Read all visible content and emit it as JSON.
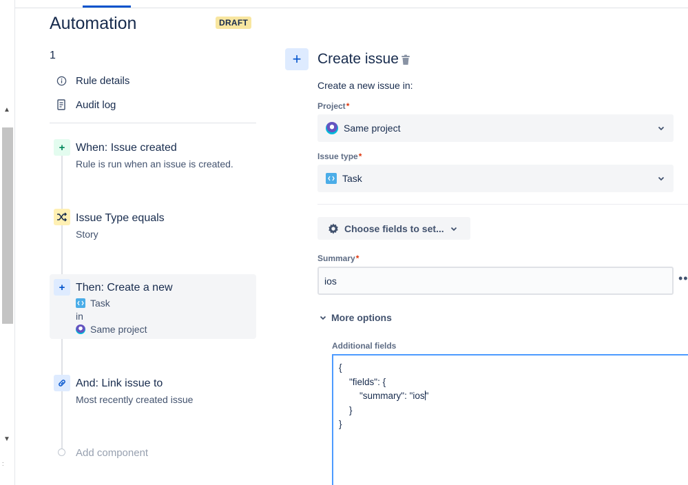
{
  "header": {
    "title": "Automation",
    "badge": "DRAFT",
    "rule_number": "1"
  },
  "menu": {
    "rule_details": "Rule details",
    "audit_log": "Audit log"
  },
  "rule_steps": [
    {
      "title": "When: Issue created",
      "subtitle": "Rule is run when an issue is created.",
      "icon": "plus-icon",
      "color": "#e3fcef"
    },
    {
      "title": "Issue Type equals",
      "subtitle": "Story",
      "icon": "shuffle-icon",
      "color": "#fff0b3"
    },
    {
      "title": "Then: Create a new",
      "line1": "Task",
      "line2": "in",
      "line3": "Same project",
      "icon": "plus-icon",
      "color": "#deebff"
    },
    {
      "title": "And: Link issue to",
      "subtitle": "Most recently created issue",
      "icon": "link-icon",
      "color": "#deebff"
    }
  ],
  "add_component": "Add component",
  "action": {
    "title": "Create issue",
    "description": "Create a new issue in:",
    "project_label": "Project",
    "project_value": "Same project",
    "issue_type_label": "Issue type",
    "issue_type_value": "Task",
    "required_mark": "*",
    "choose_fields_label": "Choose fields to set...",
    "summary_label": "Summary",
    "summary_value": "ios",
    "more_dots": "••",
    "more_options_label": "More options",
    "additional_fields_label": "Additional fields",
    "json_lines": [
      "{",
      "    \"fields\": {",
      "        \"summary\": \"ios",
      "    }",
      "}"
    ],
    "json_caret_suffix": "\""
  },
  "colors": {
    "accent": "#0052cc",
    "draft_badge": "#f8e6a0",
    "focus_border": "#4c9aff"
  }
}
